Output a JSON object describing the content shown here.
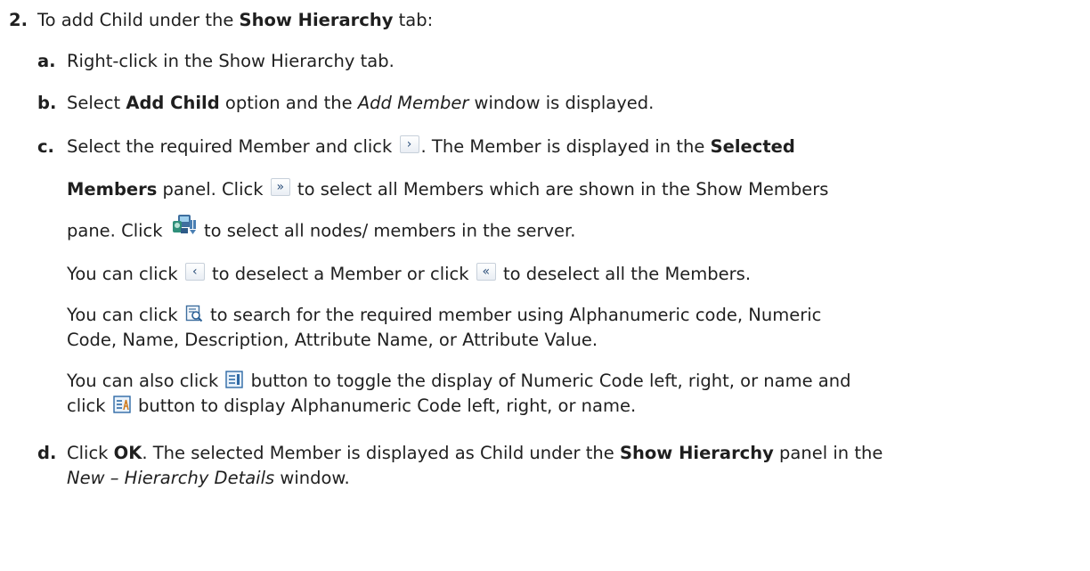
{
  "step": {
    "number": "2.",
    "intro_pre": "To add Child under the ",
    "intro_bold": "Show Hierarchy",
    "intro_post": " tab:"
  },
  "substeps": {
    "a": {
      "label": "a.",
      "text": "Right-click in the Show Hierarchy tab."
    },
    "b": {
      "label": "b.",
      "pre": "Select ",
      "bold": "Add Child",
      "mid": " option and the ",
      "italic": "Add Member",
      "post": " window is displayed."
    },
    "c": {
      "label": "c.",
      "l1_pre": "Select the required Member and click ",
      "l1_post": ". The Member is displayed in the ",
      "l1_bold": "Selected",
      "l2_bold": "Members",
      "l2_pre": " panel. Click ",
      "l2_post": " to select all Members which are shown in the Show Members",
      "l3_pre": "pane. Click ",
      "l3_post": " to select all nodes/ members in the server.",
      "p2_pre": "You can click ",
      "p2_mid": " to deselect a Member or click ",
      "p2_post": " to deselect all the Members.",
      "p3_pre": "You can click ",
      "p3_post": " to search for the required member using Alphanumeric code, Numeric",
      "p3_l2": "Code, Name, Description, Attribute Name, or Attribute Value.",
      "p4_pre": "You can also click ",
      "p4_post": " button to toggle the display of Numeric Code left, right, or name and",
      "p4_l2_pre": "click ",
      "p4_l2_post": " button to display Alphanumeric Code left, right, or name."
    },
    "d": {
      "label": "d.",
      "pre": "Click ",
      "bold1": "OK",
      "mid": ". The selected Member is displayed as Child under the ",
      "bold2": "Show Hierarchy",
      "post": " panel in the",
      "l2_italic": "New – Hierarchy Details",
      "l2_post": " window."
    }
  },
  "icons": {
    "select": "›",
    "select_all": "»",
    "deselect": "‹",
    "deselect_all": "«"
  }
}
